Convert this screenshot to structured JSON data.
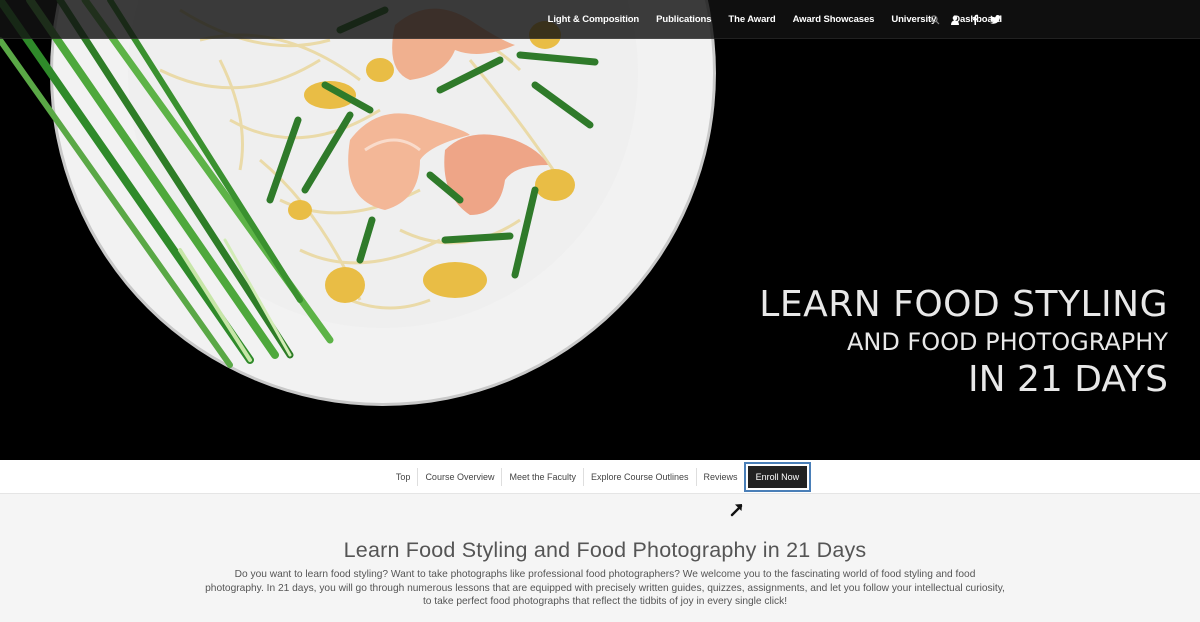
{
  "nav": {
    "items": [
      "Light & Composition",
      "Publications",
      "The Award",
      "Award Showcases",
      "University",
      "Dashboard"
    ],
    "icons": [
      "search-icon",
      "user-icon",
      "facebook-icon",
      "twitter-icon"
    ]
  },
  "hero": {
    "line1": "LEARN FOOD STYLING",
    "line2": "AND FOOD PHOTOGRAPHY",
    "line3": "IN 21 DAYS"
  },
  "subnav": {
    "items": [
      "Top",
      "Course Overview",
      "Meet the Faculty",
      "Explore Course Outlines",
      "Reviews"
    ],
    "enroll_label": "Enroll Now"
  },
  "intro": {
    "title": "Learn Food Styling and Food Photography in 21 Days",
    "text": "Do you want to learn food styling? Want to take photographs like professional food photographers? We welcome you to the fascinating world of food styling and food photography. In 21 days, you will go through numerous lessons that are equipped with precisely written guides, quizzes, assignments, and let you follow your intellectual curiosity, to take perfect food photographs that reflect the tidbits of joy in every single click!"
  },
  "colors": {
    "accent_border": "#4a7fb8",
    "enroll_bg": "#222222",
    "hero_bg": "#000000"
  }
}
